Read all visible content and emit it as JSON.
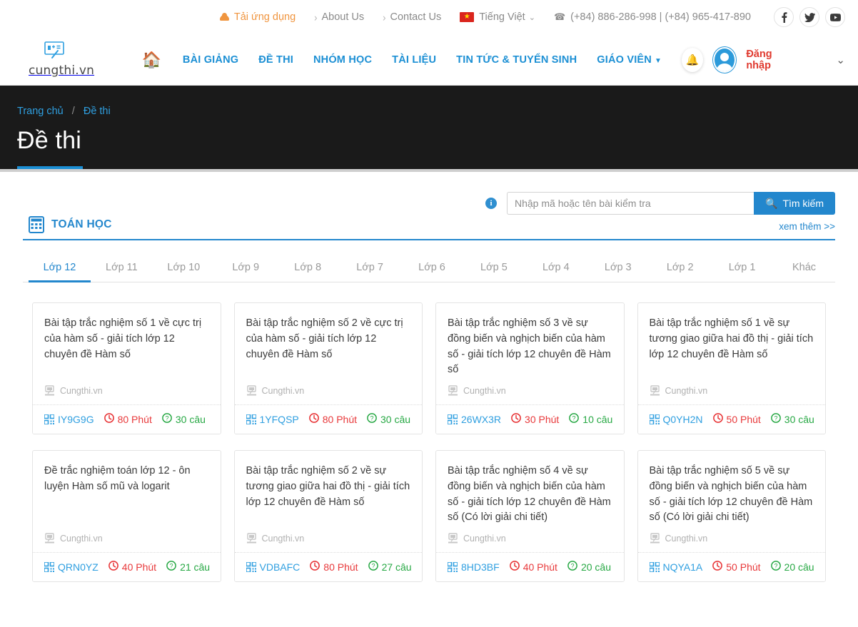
{
  "topbar": {
    "app_link": "Tải ứng dụng",
    "app_icon": "android-icon",
    "links": [
      {
        "label": "About Us",
        "icon": "chevron-right-icon"
      },
      {
        "label": "Contact Us",
        "icon": "chevron-right-icon"
      }
    ],
    "language": "Tiếng Việt",
    "language_flag": "vietnam-flag-icon",
    "phone": "(+84) 886-286-998 | (+84) 965-417-890",
    "phone_icon": "phone-icon",
    "social": [
      {
        "name": "facebook-icon",
        "glyph": "f"
      },
      {
        "name": "twitter-icon",
        "glyph": "t"
      },
      {
        "name": "youtube-icon",
        "glyph": "y"
      }
    ]
  },
  "nav": {
    "logo_text": "cungthi.vn",
    "logo_icon": "cungthi-logo-icon",
    "home_icon": "home-icon",
    "items": [
      {
        "label": "BÀI GIẢNG"
      },
      {
        "label": "ĐỀ THI"
      },
      {
        "label": "NHÓM HỌC"
      },
      {
        "label": "TÀI LIỆU"
      },
      {
        "label": "TIN TỨC & TUYỂN SINH"
      },
      {
        "label": "GIÁO VIÊN",
        "caret": "▾"
      }
    ],
    "bell_icon": "bell-icon",
    "avatar_icon": "user-avatar-icon",
    "login_label": "Đăng nhập",
    "user_caret": "⌄"
  },
  "page_header": {
    "breadcrumb": [
      {
        "label": "Trang chủ"
      },
      {
        "label": "Đề thi"
      }
    ],
    "breadcrumb_sep": "/",
    "title": "Đề thi"
  },
  "search": {
    "info_icon": "info-icon",
    "placeholder": "Nhập mã hoặc tên bài kiểm tra",
    "value": "",
    "button_label": "Tìm kiếm",
    "button_icon": "search-icon"
  },
  "subject": {
    "icon": "calculator-icon",
    "name": "TOÁN HỌC",
    "see_more": "xem thêm >>"
  },
  "tabs": {
    "active_index": 0,
    "items": [
      {
        "label": "Lớp 12"
      },
      {
        "label": "Lớp 11"
      },
      {
        "label": "Lớp 10"
      },
      {
        "label": "Lớp 9"
      },
      {
        "label": "Lớp 8"
      },
      {
        "label": "Lớp 7"
      },
      {
        "label": "Lớp 6"
      },
      {
        "label": "Lớp 5"
      },
      {
        "label": "Lớp 4"
      },
      {
        "label": "Lớp 3"
      },
      {
        "label": "Lớp 2"
      },
      {
        "label": "Lớp 1"
      },
      {
        "label": "Khác"
      }
    ]
  },
  "colors": {
    "brand_blue": "#2387cd",
    "link_blue": "#2f9fe0",
    "time_red": "#e8393b",
    "count_green": "#27a844",
    "login_red": "#e03a2f",
    "app_orange": "#f0953f",
    "header_dark": "#1a1a1a"
  },
  "cards": {
    "brand_label": "Cungthi.vn",
    "brand_icon": "cungthi-small-logo-icon",
    "code_icon": "qr-code-icon",
    "time_icon": "clock-icon",
    "count_icon": "question-mark-circle-icon",
    "items": [
      {
        "title": "Bài tập trắc nghiệm số 1 về cực trị của hàm số - giải tích lớp 12 chuyên đề Hàm số",
        "code": "IY9G9G",
        "time": "80 Phút",
        "questions": "30 câu"
      },
      {
        "title": "Bài tập trắc nghiệm số 2 về cực trị của hàm số - giải tích lớp 12 chuyên đề Hàm số",
        "code": "1YFQSP",
        "time": "80 Phút",
        "questions": "30 câu"
      },
      {
        "title": "Bài tập trắc nghiệm số 3 về sự đồng biến và nghịch biến của hàm số - giải tích lớp 12 chuyên đề Hàm số",
        "code": "26WX3R",
        "time": "30 Phút",
        "questions": "10 câu"
      },
      {
        "title": "Bài tập trắc nghiệm số 1 về sự tương giao giữa hai đồ thị - giải tích lớp 12 chuyên đề Hàm số",
        "code": "Q0YH2N",
        "time": "50 Phút",
        "questions": "30 câu"
      },
      {
        "title": "Đề trắc nghiệm toán lớp 12 - ôn luyện Hàm số mũ và logarit",
        "code": "QRN0YZ",
        "time": "40 Phút",
        "questions": "21 câu"
      },
      {
        "title": "Bài tập trắc nghiệm số 2 về sự tương giao giữa hai đồ thị - giải tích lớp 12 chuyên đề Hàm số",
        "code": "VDBAFC",
        "time": "80 Phút",
        "questions": "27 câu"
      },
      {
        "title": "Bài tập trắc nghiệm số 4 về sự đồng biến và nghịch biến của hàm số - giải tích lớp 12 chuyên đề Hàm số (Có lời giải chi tiết)",
        "code": "8HD3BF",
        "time": "40 Phút",
        "questions": "20 câu"
      },
      {
        "title": "Bài tập trắc nghiệm số 5 về sự đồng biến và nghịch biến của hàm số - giải tích lớp 12 chuyên đề Hàm số (Có lời giải chi tiết)",
        "code": "NQYA1A",
        "time": "50 Phút",
        "questions": "20 câu"
      }
    ]
  }
}
